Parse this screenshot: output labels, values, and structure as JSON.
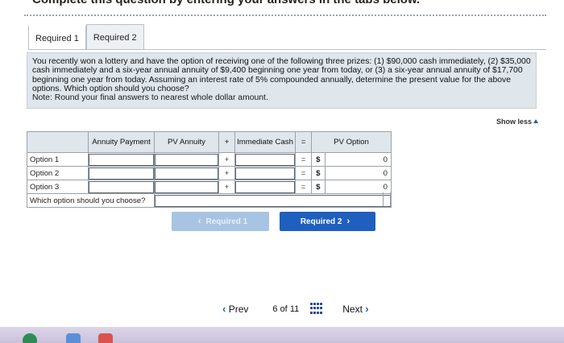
{
  "header": {
    "cut_text": "Complete this question by entering your answers in the tabs below."
  },
  "tabs": [
    {
      "label": "Required 1"
    },
    {
      "label": "Required 2"
    }
  ],
  "question": {
    "text": "You recently won a lottery and have the option of receiving one of the following three prizes: (1) $90,000 cash immediately, (2) $35,000 cash immediately and a six-year annual annuity of $9,400 beginning one year from today, or (3) a six-year annual annuity of $17,700 beginning one year from today. Assuming an interest rate of 5% compounded annually, determine the present value for the above options. Which option should you choose?",
    "note": "Note: Round your final answers to nearest whole dollar amount."
  },
  "show_less": "Show less",
  "table": {
    "headers": {
      "annuity_payment": "Annuity Payment",
      "pv_annuity": "PV Annuity",
      "plus": "+",
      "immediate_cash": "Immediate Cash",
      "equals": "=",
      "pv_option": "PV Option"
    },
    "rows": [
      {
        "label": "Option 1",
        "op1": "+",
        "op2": "=",
        "dollar": "$",
        "value": "0"
      },
      {
        "label": "Option 2",
        "op1": "+",
        "op2": "=",
        "dollar": "$",
        "value": "0"
      },
      {
        "label": "Option 3",
        "op1": "+",
        "op2": "=",
        "dollar": "$",
        "value": "0"
      }
    ],
    "choice_label": "Which option should you choose?"
  },
  "nav": {
    "prev_button": "Required 1",
    "next_button": "Required 2"
  },
  "pager": {
    "prev": "Prev",
    "current": "6",
    "of": "of",
    "total": "11",
    "next": "Next"
  },
  "colors": {
    "accent": "#1f5fbf",
    "panel": "#dfe6ec",
    "disabled_button": "#a8c4e3"
  }
}
